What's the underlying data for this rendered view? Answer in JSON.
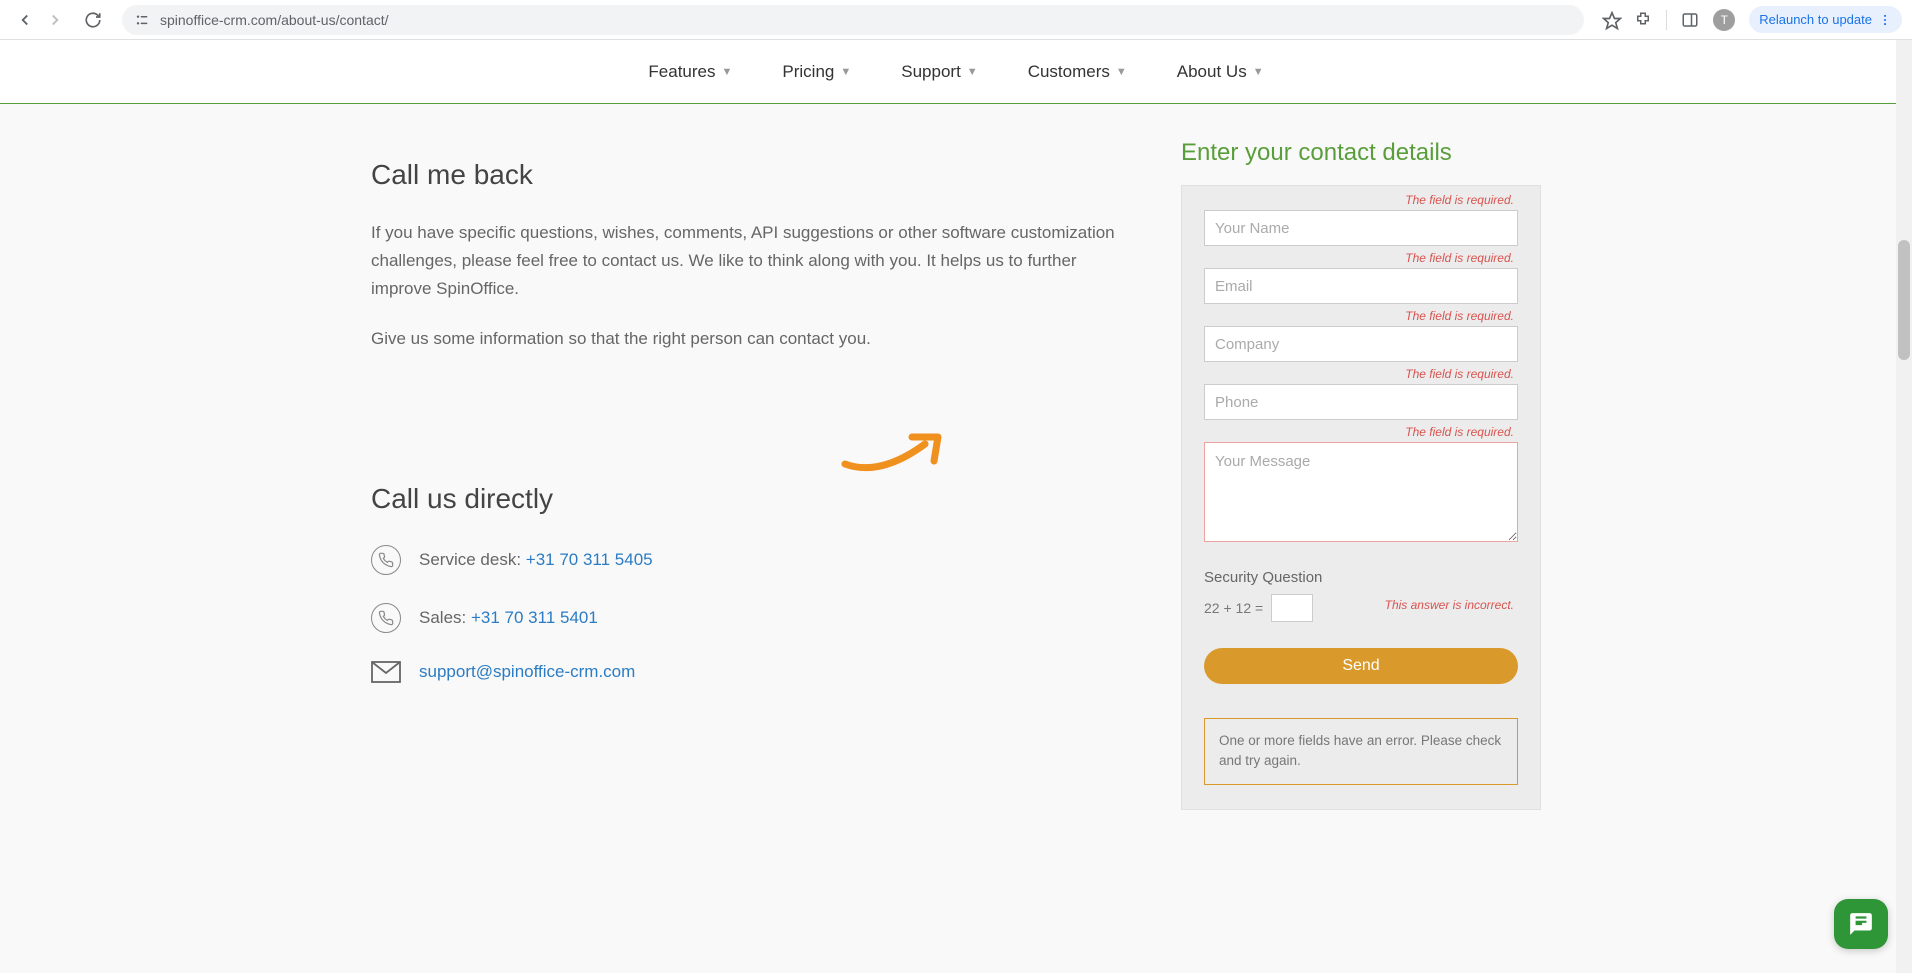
{
  "browser": {
    "url": "spinoffice-crm.com/about-us/contact/",
    "relaunch_label": "Relaunch to update",
    "profile_initial": "T"
  },
  "nav": {
    "items": [
      "Features",
      "Pricing",
      "Support",
      "Customers",
      "About Us"
    ]
  },
  "left": {
    "heading1": "Call me back",
    "para1": "If you have specific questions, wishes, comments, API suggestions or other software customization challenges, please feel free to contact us. We like to think along with you. It helps us to further improve SpinOffice.",
    "para2": "Give us some information so that the right person can contact you.",
    "heading2": "Call us directly",
    "service_desk_label": "Service desk: ",
    "service_desk_phone": "+31 70 311 5405",
    "sales_label": "Sales: ",
    "sales_phone": "+31 70 311 5401",
    "support_email": "support@spinoffice-crm.com"
  },
  "form": {
    "title": "Enter your contact details",
    "name_placeholder": "Your Name",
    "email_placeholder": "Email",
    "company_placeholder": "Company",
    "phone_placeholder": "Phone",
    "message_placeholder": "Your Message",
    "error_required": "The field is required.",
    "security_label": "Security Question",
    "security_question": "22 + 12 =",
    "security_error": "This answer is incorrect.",
    "send_label": "Send",
    "form_error": "One or more fields have an error. Please check and try again."
  }
}
